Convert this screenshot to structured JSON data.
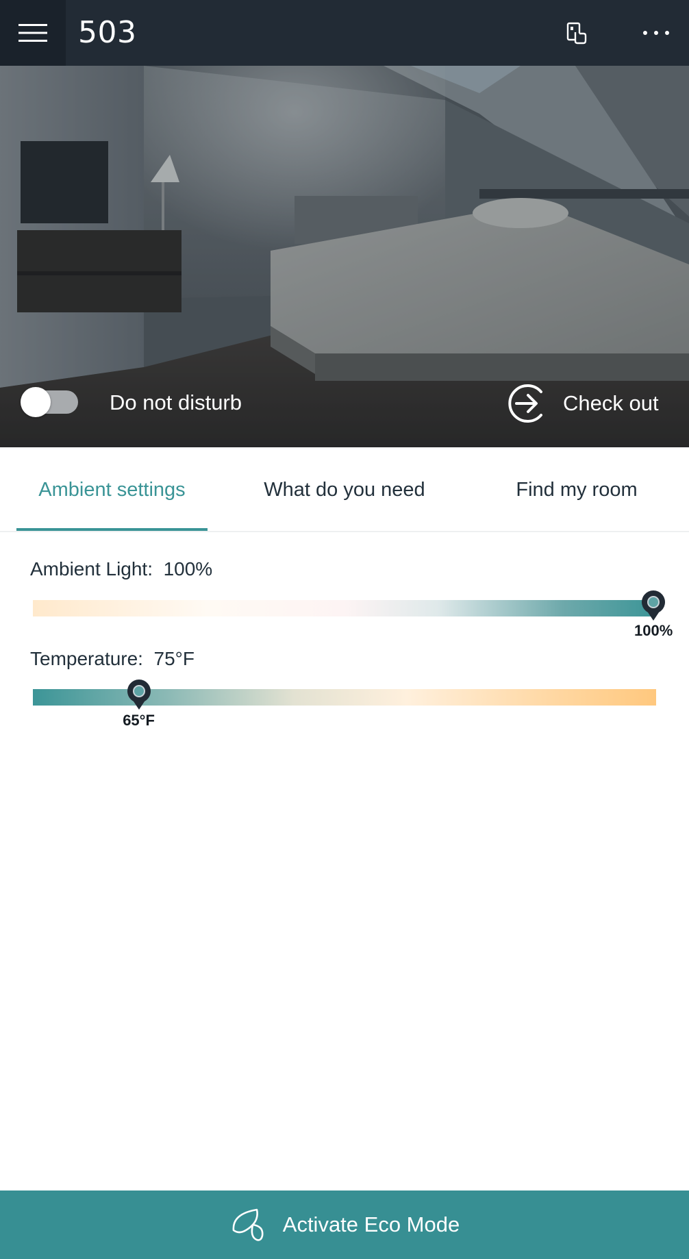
{
  "header": {
    "menu_icon": "hamburger-menu-icon",
    "title": "503",
    "key_icon": "digital-key-icon",
    "more_icon": "more-dots-icon"
  },
  "hero": {
    "image_description_icon": "hotel-room-photo",
    "do_not_disturb": {
      "label": "Do not disturb",
      "on": false
    },
    "checkout": {
      "label": "Check out",
      "icon": "checkout-arrow-icon"
    }
  },
  "tabs": [
    {
      "label": "Ambient settings",
      "active": true
    },
    {
      "label": "What do you need",
      "active": false
    },
    {
      "label": "Find my room",
      "active": false
    }
  ],
  "ambient_light": {
    "label": "Ambient Light:",
    "value": "100%",
    "slider_value": "100%",
    "level": 1.0
  },
  "temperature": {
    "label": "Temperature:",
    "value": "75°F",
    "slider_value": "65°F",
    "level": 0.17
  },
  "eco": {
    "label": "Activate Eco Mode",
    "icon": "leaf-icon"
  },
  "colors": {
    "header_bg": "#222b35",
    "accent": "#3a9496",
    "eco_bg": "#378f93"
  }
}
